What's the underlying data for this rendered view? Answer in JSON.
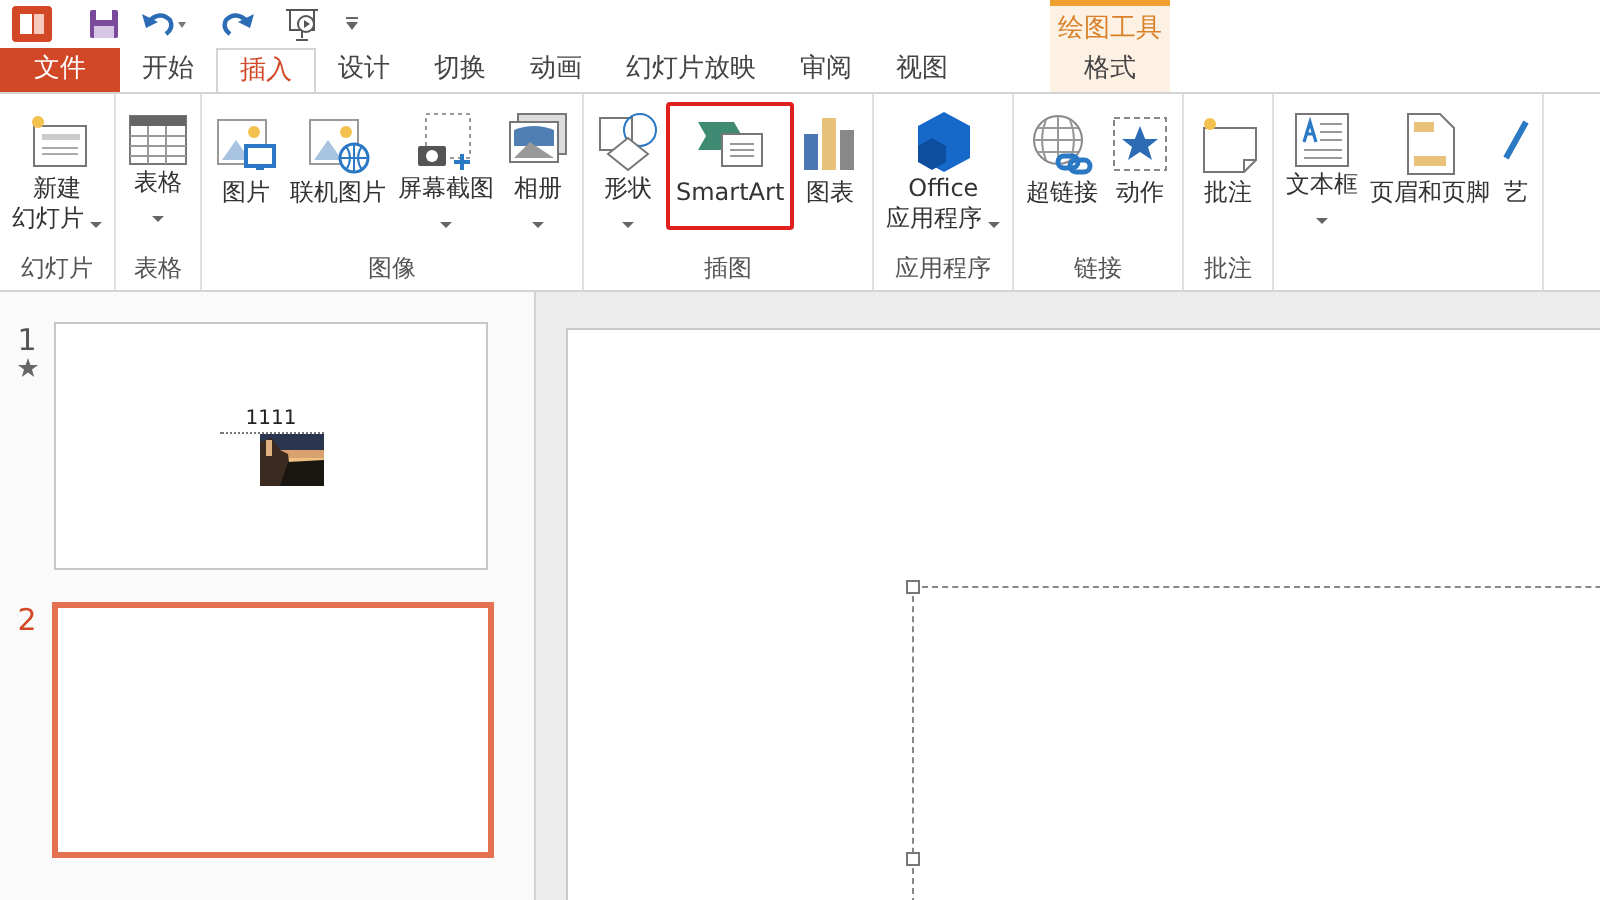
{
  "contextual_tab_group": {
    "label": "绘图工具"
  },
  "tabs": [
    {
      "label": "文件",
      "kind": "file",
      "selected": false
    },
    {
      "label": "开始",
      "kind": "normal",
      "selected": false
    },
    {
      "label": "插入",
      "kind": "normal",
      "selected": true
    },
    {
      "label": "设计",
      "kind": "normal",
      "selected": false
    },
    {
      "label": "切换",
      "kind": "normal",
      "selected": false
    },
    {
      "label": "动画",
      "kind": "normal",
      "selected": false
    },
    {
      "label": "幻灯片放映",
      "kind": "normal",
      "selected": false
    },
    {
      "label": "审阅",
      "kind": "normal",
      "selected": false
    },
    {
      "label": "视图",
      "kind": "normal",
      "selected": false
    },
    {
      "label": "格式",
      "kind": "contextual",
      "selected": false
    }
  ],
  "ribbon": {
    "groups": [
      {
        "label": "幻灯片",
        "buttons": [
          {
            "lines": [
              "新建",
              "幻灯片"
            ],
            "dropdown": true,
            "highlighted": false
          }
        ]
      },
      {
        "label": "表格",
        "buttons": [
          {
            "lines": [
              "表格"
            ],
            "dropdown": true,
            "highlighted": false
          }
        ]
      },
      {
        "label": "图像",
        "buttons": [
          {
            "lines": [
              "图片"
            ],
            "dropdown": false,
            "highlighted": false
          },
          {
            "lines": [
              "联机图片"
            ],
            "dropdown": false,
            "highlighted": false
          },
          {
            "lines": [
              "屏幕截图"
            ],
            "dropdown": true,
            "highlighted": false
          },
          {
            "lines": [
              "相册"
            ],
            "dropdown": true,
            "highlighted": false
          }
        ]
      },
      {
        "label": "插图",
        "buttons": [
          {
            "lines": [
              "形状"
            ],
            "dropdown": true,
            "highlighted": false
          },
          {
            "lines": [
              "SmartArt"
            ],
            "dropdown": false,
            "highlighted": true
          },
          {
            "lines": [
              "图表"
            ],
            "dropdown": false,
            "highlighted": false
          }
        ]
      },
      {
        "label": "应用程序",
        "buttons": [
          {
            "lines": [
              "Office",
              "应用程序"
            ],
            "dropdown": true,
            "highlighted": false
          }
        ]
      },
      {
        "label": "链接",
        "buttons": [
          {
            "lines": [
              "超链接"
            ],
            "dropdown": false,
            "highlighted": false
          },
          {
            "lines": [
              "动作"
            ],
            "dropdown": false,
            "highlighted": false
          }
        ]
      },
      {
        "label": "批注",
        "buttons": [
          {
            "lines": [
              "批注"
            ],
            "dropdown": false,
            "highlighted": false
          }
        ]
      },
      {
        "buttons": [
          {
            "lines": [
              "文本框"
            ],
            "dropdown": true,
            "highlighted": false
          },
          {
            "lines": [
              "页眉和页脚"
            ],
            "dropdown": false,
            "highlighted": false
          },
          {
            "lines": [
              "艺"
            ],
            "dropdown": false,
            "highlighted": false
          }
        ]
      }
    ]
  },
  "slides": [
    {
      "number": "1",
      "animated": true,
      "selected": false,
      "title": "1111",
      "kind": "picture"
    },
    {
      "number": "2",
      "animated": false,
      "selected": true
    }
  ]
}
